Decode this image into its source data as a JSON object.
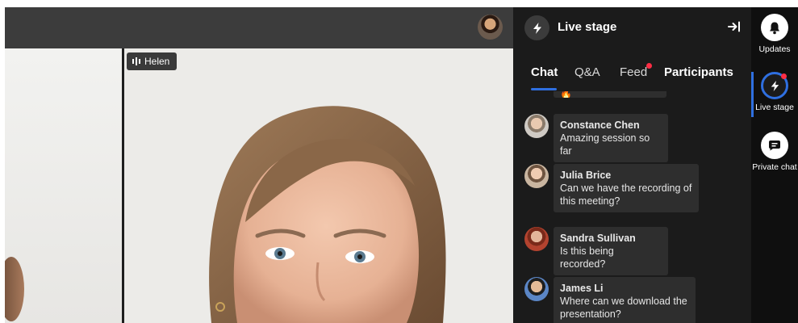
{
  "video": {
    "speaker_name": "Helen"
  },
  "panel": {
    "title": "Live stage",
    "tabs": [
      {
        "label": "Chat"
      },
      {
        "label": "Q&A"
      },
      {
        "label": "Feed"
      },
      {
        "label": "Participants"
      }
    ],
    "partial_message_text": "So Excited!!! 🔥🔥🔥🔥",
    "messages": [
      {
        "name": "Constance Chen",
        "lines": [
          "Amazing session so far"
        ],
        "avatar_color": "#cfcac4"
      },
      {
        "name": "Julia Brice",
        "lines": [
          "Can we have the recording of",
          "this meeting?"
        ],
        "avatar_color": "#c9b5a0"
      },
      {
        "name": "Sandra Sullivan",
        "lines": [
          "Is this being recorded?"
        ],
        "avatar_color": "#b3432f"
      },
      {
        "name": "James Li",
        "lines": [
          "Where can we download the",
          "presentation?"
        ],
        "avatar_color": "#5b86c6"
      }
    ]
  },
  "rail": {
    "items": [
      {
        "label": "Updates",
        "icon": "bell-icon"
      },
      {
        "label": "Live stage",
        "icon": "lightning-icon"
      },
      {
        "label": "Private chat",
        "icon": "chat-bubble-icon"
      }
    ]
  },
  "colors": {
    "accent": "#2f6fe0",
    "notification": "#ff2d45",
    "panel_bg": "#1b1b1b"
  }
}
